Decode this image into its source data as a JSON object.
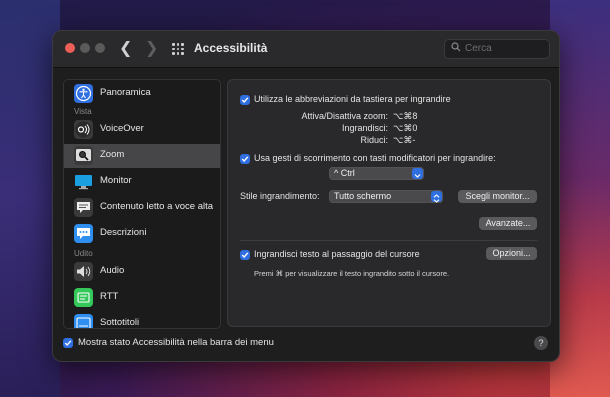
{
  "window": {
    "title": "Accessibilità",
    "search_placeholder": "Cerca"
  },
  "sidebar": {
    "headers": {
      "vista": "Vista",
      "udito": "Udito"
    },
    "items": [
      {
        "label": "Panoramica",
        "icon": "accessibility-icon",
        "color": "#2f6fe0"
      },
      {
        "label": "VoiceOver",
        "icon": "voiceover-icon",
        "color": "#3a3a3a"
      },
      {
        "label": "Zoom",
        "icon": "zoom-icon",
        "color": "#3a3a3a"
      },
      {
        "label": "Monitor",
        "icon": "monitor-icon",
        "color": "#1aa0e0"
      },
      {
        "label": "Contenuto letto a voce alta",
        "icon": "speech-bubble-icon",
        "color": "#3a3a3a"
      },
      {
        "label": "Descrizioni",
        "icon": "descriptions-icon",
        "color": "#2f8ff0"
      },
      {
        "label": "Audio",
        "icon": "speaker-icon",
        "color": "#3a3a3a"
      },
      {
        "label": "RTT",
        "icon": "rtt-icon",
        "color": "#34c759"
      },
      {
        "label": "Sottotitoli",
        "icon": "subtitles-icon",
        "color": "#2f8ff0"
      }
    ],
    "selected": "Zoom"
  },
  "panel": {
    "shortcuts_checkbox": "Utilizza le abbreviazioni da tastiera per ingrandire",
    "shortcuts": [
      {
        "label": "Attiva/Disattiva zoom:",
        "keys": "⌥⌘8"
      },
      {
        "label": "Ingrandisci:",
        "keys": "⌥⌘0"
      },
      {
        "label": "Riduci:",
        "keys": "⌥⌘-"
      }
    ],
    "scroll_checkbox": "Usa gesti di scorrimento con tasti modificatori per ingrandire:",
    "modifier_select": "^ Ctrl",
    "zoom_style_label": "Stile ingrandimento:",
    "zoom_style_select": "Tutto schermo",
    "choose_monitor_button": "Scegli monitor...",
    "advanced_button": "Avanzate...",
    "hover_text_checkbox": "Ingrandisci testo al passaggio del cursore",
    "options_button": "Opzioni...",
    "hover_note": "Premi ⌘ per visualizzare il testo ingrandito sotto il cursore."
  },
  "footer": {
    "menu_bar_checkbox": "Mostra stato Accessibilità nella barra dei menu",
    "help_label": "?"
  },
  "colors": {
    "accent": "#2f6fe0",
    "close": "#ec5f57"
  }
}
